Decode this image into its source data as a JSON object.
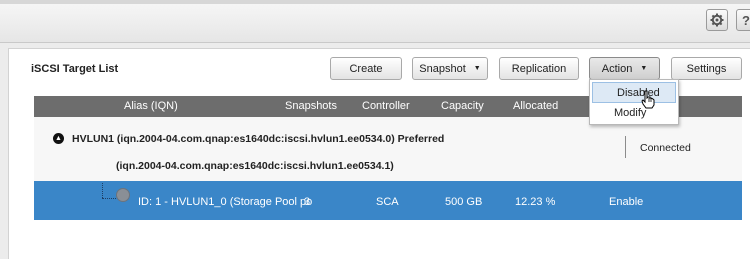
{
  "toolbar": {
    "settings_icon": "gear-icon",
    "help_label": "?"
  },
  "panel": {
    "title": "iSCSI Target List",
    "buttons": {
      "create": "Create",
      "snapshot": "Snapshot",
      "replication": "Replication",
      "action": "Action",
      "settings": "Settings"
    }
  },
  "grid": {
    "columns": [
      "Alias (IQN)",
      "Snapshots",
      "Controller",
      "Capacity",
      "Allocated"
    ],
    "target": {
      "title": "HVLUN1 (iqn.2004-04.com.qnap:es1640dc:iscsi.hvlun1.ee0534.0) Preferred",
      "iqn_alt": "(iqn.2004-04.com.qnap:es1640dc:iscsi.hvlun1.ee0534.1)",
      "status": "Connected"
    },
    "lun": {
      "id": "ID: 1 - HVLUN1_0 (Storage Pool po",
      "snapshots": "3",
      "controller": "SCA",
      "capacity": "500 GB",
      "allocated": "12.23 %",
      "status": "Enable"
    }
  },
  "action_menu": {
    "items": [
      "Disabled",
      "Modify"
    ]
  },
  "colors": {
    "header_bg": "#6d6d6d",
    "selected_row": "#3a86c8"
  }
}
